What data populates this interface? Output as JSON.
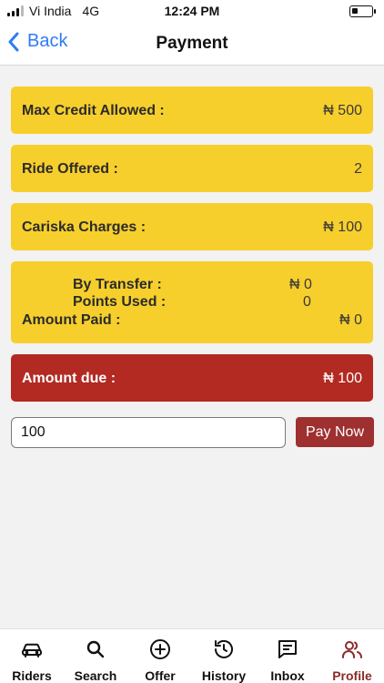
{
  "status_bar": {
    "carrier": "Vi India",
    "network": "4G",
    "time": "12:24 PM"
  },
  "nav": {
    "back_label": "Back",
    "title": "Payment"
  },
  "cards": {
    "max_credit": {
      "label": "Max Credit Allowed :",
      "value": "₦ 500"
    },
    "ride_offered": {
      "label": "Ride Offered :",
      "value": "2"
    },
    "cariska_charges": {
      "label": "Cariska Charges :",
      "value": "₦ 100"
    },
    "amount_paid": {
      "by_transfer_label": "By Transfer :",
      "by_transfer_value": "₦ 0",
      "points_used_label": "Points Used :",
      "points_used_value": "0",
      "label": "Amount Paid :",
      "value": "₦ 0"
    },
    "amount_due": {
      "label": "Amount due :",
      "value": "₦ 100"
    }
  },
  "payment": {
    "amount_value": "100",
    "pay_button": "Pay Now"
  },
  "tabs": [
    {
      "label": "Riders",
      "icon": "car-icon"
    },
    {
      "label": "Search",
      "icon": "search-icon"
    },
    {
      "label": "Offer",
      "icon": "plus-circle-icon"
    },
    {
      "label": "History",
      "icon": "history-icon"
    },
    {
      "label": "Inbox",
      "icon": "message-icon"
    },
    {
      "label": "Profile",
      "icon": "users-icon"
    }
  ],
  "colors": {
    "card_yellow": "#f7cf2c",
    "due_red": "#b22a22",
    "pay_button": "#9e3030",
    "active_tab": "#8c2b2b",
    "link_blue": "#2f7cf6"
  }
}
